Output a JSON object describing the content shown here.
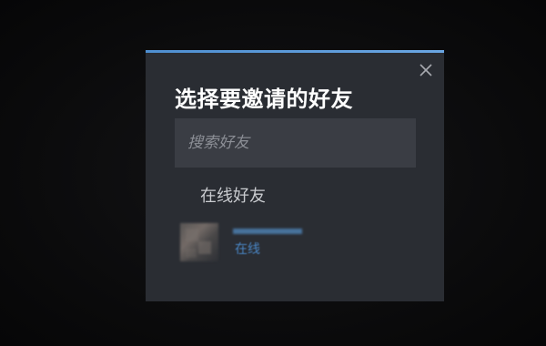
{
  "dialog": {
    "title": "选择要邀请的好友",
    "close_icon": "close-icon",
    "accent_color": "#4e8fd1"
  },
  "search": {
    "placeholder": "搜索好友",
    "value": ""
  },
  "section": {
    "online_friends_label": "在线好友"
  },
  "friends": [
    {
      "name_obscured": true,
      "status": "在线",
      "status_color": "#4a86c5"
    }
  ]
}
